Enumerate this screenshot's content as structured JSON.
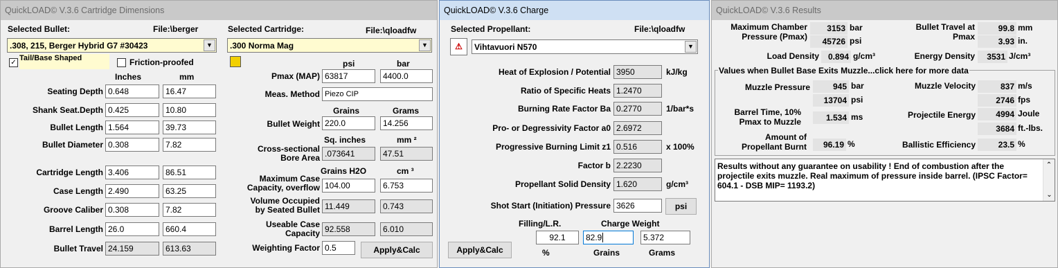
{
  "dims": {
    "title": "QuickLOAD© V.3.6 Cartridge Dimensions",
    "sel_bullet_label": "Selected Bullet:",
    "bullet_file": "File:\\berger",
    "bullet_value": ".308, 215, Berger Hybrid G7 #30423",
    "tail_label": "Tail/Base Shaped",
    "friction_label": "Friction-proofed",
    "hdr_inches": "Inches",
    "hdr_mm": "mm",
    "rows": [
      {
        "label": "Seating Depth",
        "in": "0.648",
        "mm": "16.47"
      },
      {
        "label": "Shank Seat.Depth",
        "in": "0.425",
        "mm": "10.80"
      },
      {
        "label": "Bullet Length",
        "in": "1.564",
        "mm": "39.73"
      },
      {
        "label": "Bullet Diameter",
        "in": "0.308",
        "mm": "7.82"
      },
      {
        "label": "Cartridge Length",
        "in": "3.406",
        "mm": "86.51"
      },
      {
        "label": "Case Length",
        "in": "2.490",
        "mm": "63.25"
      },
      {
        "label": "Groove Caliber",
        "in": "0.308",
        "mm": "7.82"
      },
      {
        "label": "Barrel Length",
        "in": "26.0",
        "mm": "660.4"
      },
      {
        "label": "Bullet Travel",
        "in": "24.159",
        "mm": "613.63"
      }
    ],
    "sel_cart_label": "Selected Cartridge:",
    "cart_file": "File:\\qloadfw",
    "cart_value": ".300 Norma Mag",
    "hdr_psi": "psi",
    "hdr_bar": "bar",
    "pmax_label": "Pmax (MAP)",
    "pmax_psi": "63817",
    "pmax_bar": "4400.0",
    "meas_label": "Meas. Method",
    "meas_value": "Piezo CIP",
    "hdr_grains": "Grains",
    "hdr_grams": "Grams",
    "bw_label": "Bullet Weight",
    "bw_grains": "220.0",
    "bw_grams": "14.256",
    "hdr_sqin": "Sq. inches",
    "hdr_mm2": "mm ²",
    "bore_label1": "Cross-sectional",
    "bore_label2": "Bore Area",
    "bore_sqin": ".073641",
    "bore_mm2": "47.51",
    "hdr_grainsh2o": "Grains H2O",
    "hdr_cm3": "cm ³",
    "mcc_label1": "Maximum Case",
    "mcc_label2": "Capacity, overflow",
    "mcc_gr": "104.00",
    "mcc_cm": "6.753",
    "vol_label1": "Volume Occupied",
    "vol_label2": "by Seated Bullet",
    "vol_gr": "11.449",
    "vol_cm": "0.743",
    "ucc_label1": "Useable Case",
    "ucc_label2": "Capacity",
    "ucc_gr": "92.558",
    "ucc_cm": "6.010",
    "wf_label": "Weighting Factor",
    "wf_value": "0.5",
    "apply_label": "Apply&Calc"
  },
  "charge": {
    "title": "QuickLOAD© V.3.6 Charge",
    "sel_prop_label": "Selected Propellant:",
    "prop_file": "File:\\qloadfw",
    "prop_value": "Vihtavuori N570",
    "rows": [
      {
        "label": "Heat of Explosion / Potential",
        "value": "3950",
        "unit": "kJ/kg"
      },
      {
        "label": "Ratio of Specific Heats",
        "value": "1.2470",
        "unit": ""
      },
      {
        "label": "Burning Rate Factor  Ba",
        "value": "0.2770",
        "unit": "1/bar*s"
      },
      {
        "label": "Pro- or Degressivity Factor  a0",
        "value": "2.6972",
        "unit": ""
      },
      {
        "label": "Progressive Burning Limit z1",
        "value": "0.516",
        "unit": "x 100%"
      },
      {
        "label": "Factor  b",
        "value": "2.2230",
        "unit": ""
      },
      {
        "label": "Propellant Solid Density",
        "value": "1.620",
        "unit": "g/cm³"
      },
      {
        "label": "Shot Start (Initiation) Pressure",
        "value": "3626",
        "unit": ""
      }
    ],
    "psi_btn": "psi",
    "filling_label": "Filling/L.R.",
    "charge_weight_label": "Charge Weight",
    "filling_value": "92.1",
    "charge_grains": "82.9",
    "charge_grams": "5.372",
    "pct": "%",
    "grains": "Grains",
    "grams": "Grams",
    "apply_label": "Apply&Calc"
  },
  "results": {
    "title": "QuickLOAD© V.3.6 Results",
    "max_chamber1": "Maximum Chamber",
    "max_chamber2": "Pressure (Pmax)",
    "pmax_bar": "3153",
    "u_bar": "bar",
    "pmax_psi": "45726",
    "u_psi": "psi",
    "bt_pmax1": "Bullet Travel at",
    "bt_pmax2": "Pmax",
    "bt_mm": "99.8",
    "u_mm": "mm",
    "bt_in": "3.93",
    "u_in": "in.",
    "ld_label": "Load Density",
    "ld_value": "0.894",
    "u_gcm3": "g/cm³",
    "ed_label": "Energy Density",
    "ed_value": "3531",
    "u_jcm3": "J/cm³",
    "muzzle_group": "Values when Bullet Base Exits Muzzle...click here for more data",
    "mp_label": "Muzzle Pressure",
    "mp_bar": "945",
    "mp_psi": "13704",
    "mv_label": "Muzzle Velocity",
    "mv_ms": "837",
    "u_ms": "m/s",
    "mv_fps": "2746",
    "u_fps": "fps",
    "bt_label1": "Barrel Time, 10%",
    "bt_label2": "Pmax to Muzzle",
    "bt_value": "1.534",
    "u_ms2": "ms",
    "pe_label": "Projectile Energy",
    "pe_joule": "4994",
    "u_joule": "Joule",
    "pe_ftlbs": "3684",
    "u_ftlbs": "ft.-lbs.",
    "amt_label1": "Amount of",
    "amt_label2": "Propellant Burnt",
    "amt_value": "96.19",
    "u_pct": "%",
    "be_label": "Ballistic Efficiency",
    "be_value": "23.5",
    "u_pct2": "%",
    "notes": "Results without any guarantee on usability !  End of combustion after the projectile exits muzzle.  Real maximum of pressure inside barrel.  (IPSC Factor= 604.1 - DSB MIP= 1193.2)"
  }
}
